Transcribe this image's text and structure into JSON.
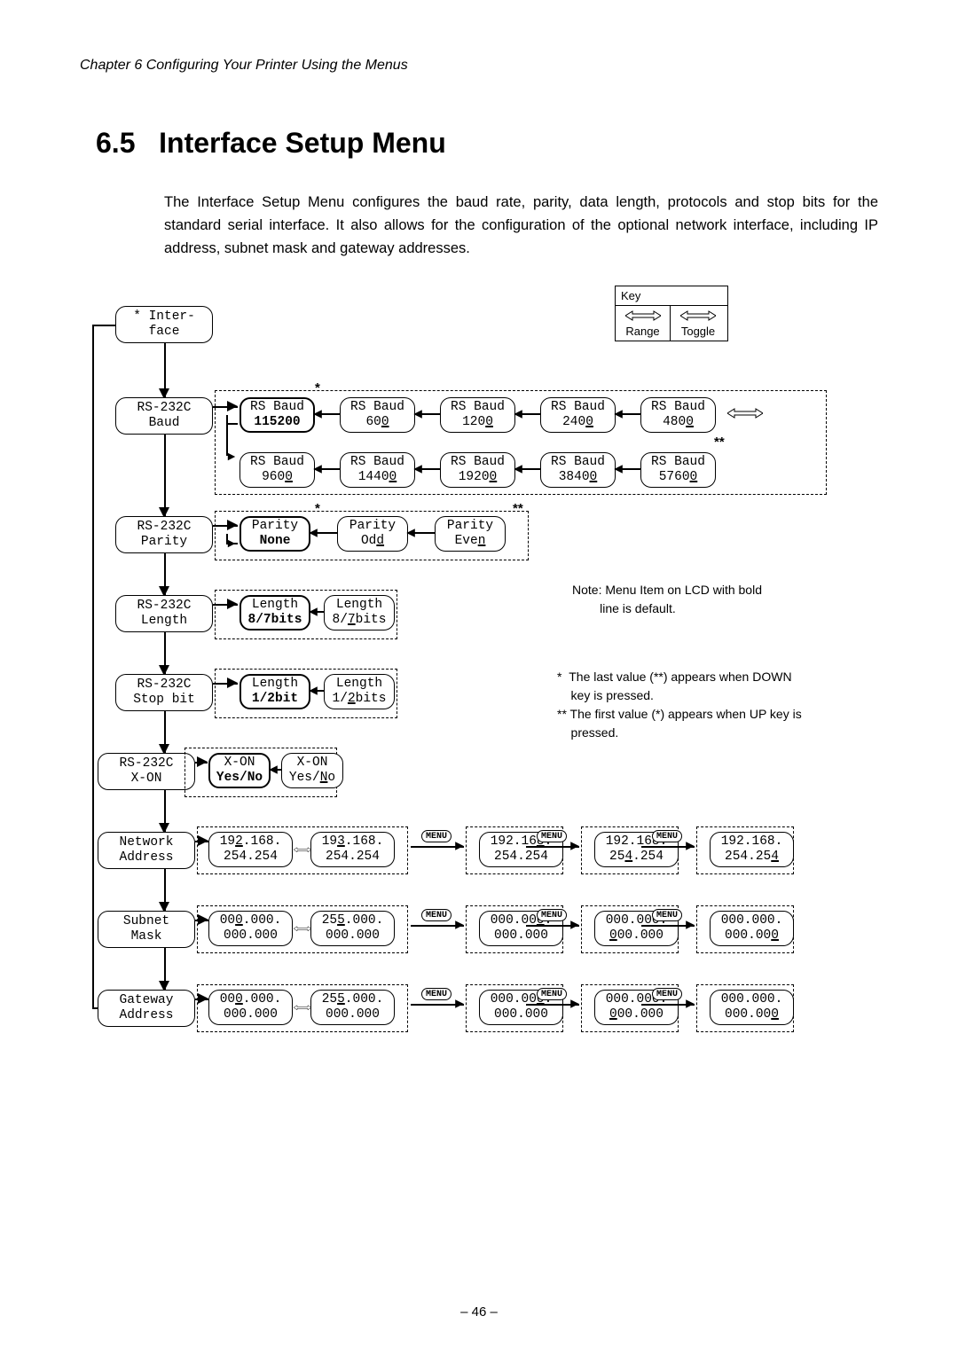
{
  "header": {
    "chapter": "Chapter 6    Configuring Your Printer Using the Menus"
  },
  "section": {
    "number": "6.5",
    "title": "Interface Setup Menu"
  },
  "intro": "The Interface Setup Menu configures the baud rate, parity, data length, protocols and stop bits for the standard serial interface.  It also allows for the configuration of the optional network interface, including IP address, subnet mask and gateway addresses.",
  "key": {
    "title": "Key",
    "left": "Range",
    "right": "Toggle"
  },
  "diagram": {
    "root": {
      "line1": "* Inter-",
      "line2": "face"
    },
    "rows": [
      {
        "head": {
          "line1": "RS-232C",
          "line2": "Baud"
        },
        "opts": [
          {
            "line1": "RS Baud",
            "line2": "115200",
            "bold_all": true
          },
          {
            "line1": "RS Baud",
            "line2": "60",
            "u": "0"
          },
          {
            "line1": "RS Baud",
            "line2": "120",
            "u": "0"
          },
          {
            "line1": "RS Baud",
            "line2": "240",
            "u": "0"
          },
          {
            "line1": "RS Baud",
            "line2": "480",
            "u": "0"
          }
        ],
        "opts2": [
          {
            "line1": "RS Baud",
            "line2": "960",
            "u": "0"
          },
          {
            "line1": "RS Baud",
            "line2": "1440",
            "u": "0"
          },
          {
            "line1": "RS Baud",
            "line2": "1920",
            "u": "0"
          },
          {
            "line1": "RS Baud",
            "line2": "3840",
            "u": "0"
          },
          {
            "line1": "RS Baud",
            "line2": "5760",
            "u": "0"
          }
        ]
      },
      {
        "head": {
          "line1": "RS-232C",
          "line2": "Parity"
        },
        "opts": [
          {
            "line1": "Parity",
            "line2": "None",
            "bold_all": true
          },
          {
            "line1": "Parity",
            "line2": "Od",
            "u": "d"
          },
          {
            "line1": "Parity",
            "line2": "Eve",
            "u": "n"
          }
        ]
      },
      {
        "head": {
          "line1": "RS-232C",
          "line2": "Length"
        },
        "opts": [
          {
            "line1": "Length",
            "line2": "8/7bits",
            "bold_all": true
          },
          {
            "line1": "Length",
            "line2": "8/",
            "u": "7",
            "after": "bits"
          }
        ]
      },
      {
        "head": {
          "line1": "RS-232C",
          "line2": "Stop bit"
        },
        "opts": [
          {
            "line1": "Length",
            "line2": "1/2bit",
            "bold_all": true
          },
          {
            "line1": "Length",
            "line2": "1/",
            "u": "2",
            "after": "bits"
          }
        ]
      },
      {
        "head": {
          "line1": "RS-232C",
          "line2": "X-ON"
        },
        "opts": [
          {
            "line1": "X-ON",
            "line2": "Yes/No",
            "bold_all": true
          },
          {
            "line1": "X-ON",
            "line2": "Yes/",
            "u": "N",
            "after": "o"
          }
        ]
      },
      {
        "head": {
          "line1": "Network",
          "line2": "Address"
        },
        "ip": [
          {
            "a": "19",
            "u": "2",
            "b": ".168.",
            "c": "254.254"
          },
          {
            "a": "19",
            "u": "3",
            "b": ".168.",
            "c": "254.254"
          },
          {
            "a": "192.16",
            "u": "8",
            "b": ".",
            "c": "254.254"
          },
          {
            "a": "192.168.",
            "u": "",
            "b": "",
            "c": "25",
            "cu": "4",
            "cd": ".254"
          },
          {
            "a": "192.168.",
            "u": "",
            "b": "",
            "c": "254.25",
            "cu": "4",
            "cd": ""
          }
        ]
      },
      {
        "head": {
          "line1": "Subnet",
          "line2": "Mask"
        },
        "ip": [
          {
            "a": "00",
            "u": "0",
            "b": ".000.",
            "c": "000.000"
          },
          {
            "a": "25",
            "u": "5",
            "b": ".000.",
            "c": "000.000"
          },
          {
            "a": "000.00",
            "u": "0",
            "b": ".",
            "c": "000.000"
          },
          {
            "a": "000.000.",
            "u": "",
            "b": "",
            "c": "",
            "cu": "0",
            "cd": "00.000"
          },
          {
            "a": "000.000.",
            "u": "",
            "b": "",
            "c": "000.00",
            "cu": "0",
            "cd": ""
          }
        ]
      },
      {
        "head": {
          "line1": "Gateway",
          "line2": "Address"
        },
        "ip": [
          {
            "a": "00",
            "u": "0",
            "b": ".000.",
            "c": "000.000"
          },
          {
            "a": "25",
            "u": "5",
            "b": ".000.",
            "c": "000.000"
          },
          {
            "a": "000.00",
            "u": "0",
            "b": ".",
            "c": "000.000"
          },
          {
            "a": "000.000.",
            "u": "",
            "b": "",
            "c": "",
            "cu": "0",
            "cd": "00.000"
          },
          {
            "a": "000.000.",
            "u": "",
            "b": "",
            "c": "000.00",
            "cu": "0",
            "cd": ""
          }
        ]
      }
    ]
  },
  "notes": {
    "bold_note": "Note: Menu Item on LCD with bold line is default.",
    "star1": "*  The last value (**) appears when DOWN key is pressed.",
    "star2": "** The first value (*) appears when UP key is pressed."
  },
  "menu_label": "MENU",
  "page_number": "– 46 –"
}
